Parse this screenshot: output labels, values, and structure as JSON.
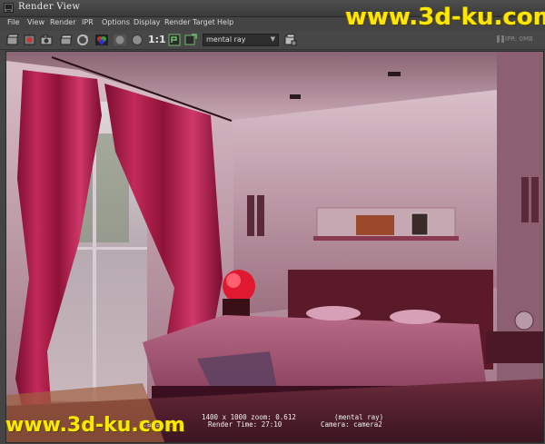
{
  "window": {
    "title": "Render View"
  },
  "menu": [
    "File",
    "View",
    "Render",
    "IPR",
    "Options",
    "Display",
    "Render Target",
    "Help"
  ],
  "toolbar": {
    "ratio_label": "1:1",
    "renderer_value": "mental ray",
    "ipr_status": "IPR: 0MB"
  },
  "status": {
    "resolution": "1400 x 1000  zoom: 0.612",
    "frame": "Frame: 1",
    "render_time": "Render Time: 27:10",
    "renderer": "(mental ray)",
    "camera": "Camera: camera2"
  },
  "watermark": {
    "text": "www.3d-ku.com"
  },
  "colors": {
    "watermark": "#ffe600",
    "ui_bg": "#444444"
  }
}
